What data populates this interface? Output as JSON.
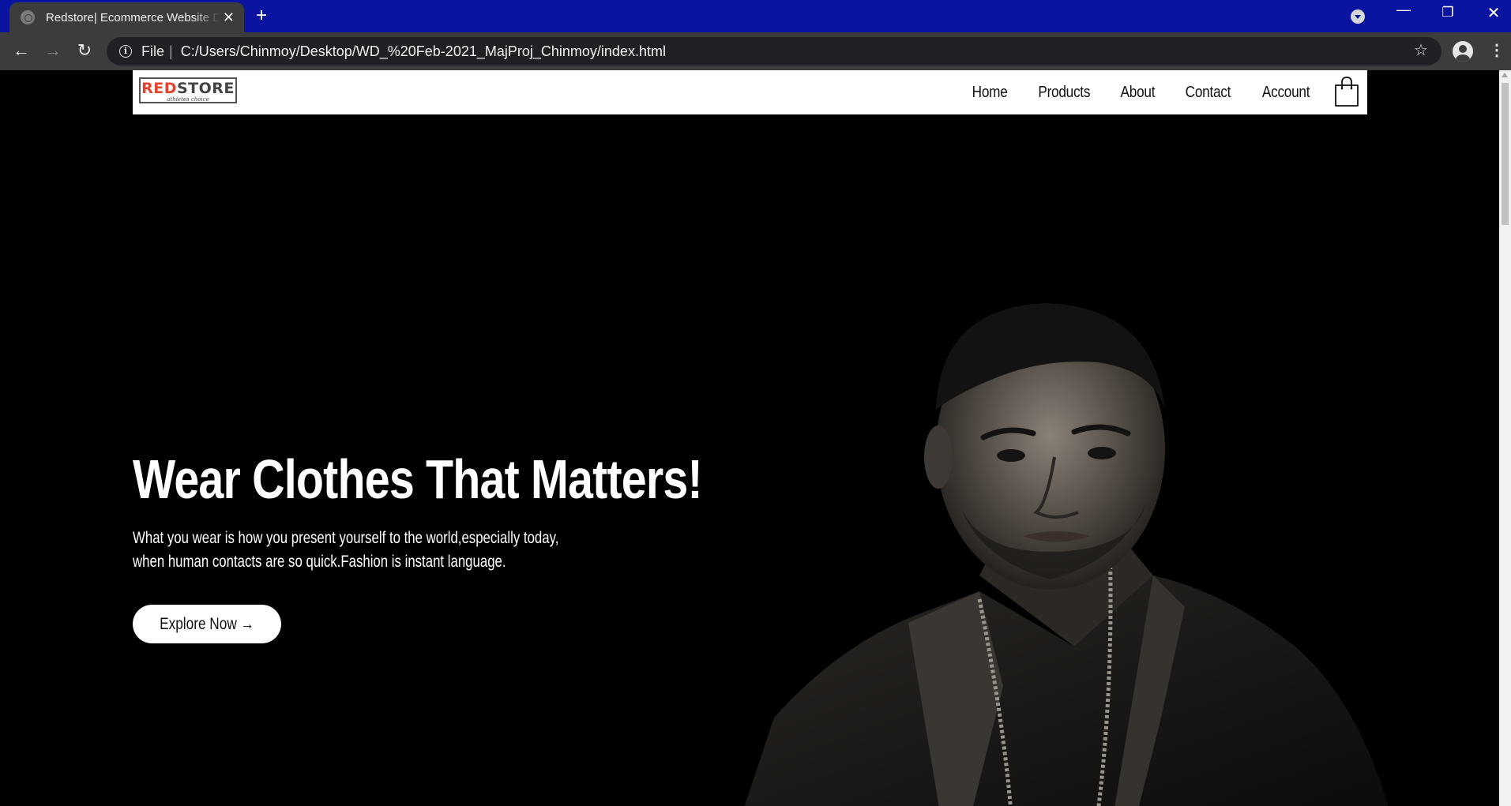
{
  "browser": {
    "tab_title": "Redstore| Ecommerce Website Design",
    "tab_close": "✕",
    "new_tab": "+",
    "address_scheme": "File",
    "address_separator": "|",
    "url": "C:/Users/Chinmoy/Desktop/WD_%20Feb-2021_MajProj_Chinmoy/index.html",
    "tabbar_color": "#0a14a0",
    "icons": [
      "back-arrow-icon",
      "forward-arrow-icon",
      "reload-icon",
      "info-icon",
      "star-icon",
      "profile-icon",
      "menu-dots-icon",
      "minimize-icon",
      "maximize-icon",
      "close-icon"
    ]
  },
  "site": {
    "logo": {
      "red_part": "RED",
      "dark_part": "STORE",
      "tagline": "athletes choice"
    },
    "nav": {
      "home": "Home",
      "products": "Products",
      "about": "About",
      "contact": "Contact",
      "account": "Account"
    },
    "cart_icon": "shopping-bag-icon",
    "hero": {
      "title": "Wear Clothes That Matters!",
      "line1": "What you wear is how you present yourself to the world,especially today,",
      "line2": "when human contacts are so quick.Fashion is instant language.",
      "button": "Explore Now →"
    },
    "colors": {
      "background": "#000000",
      "accent": "#e3432f",
      "text": "#ffffff"
    }
  }
}
